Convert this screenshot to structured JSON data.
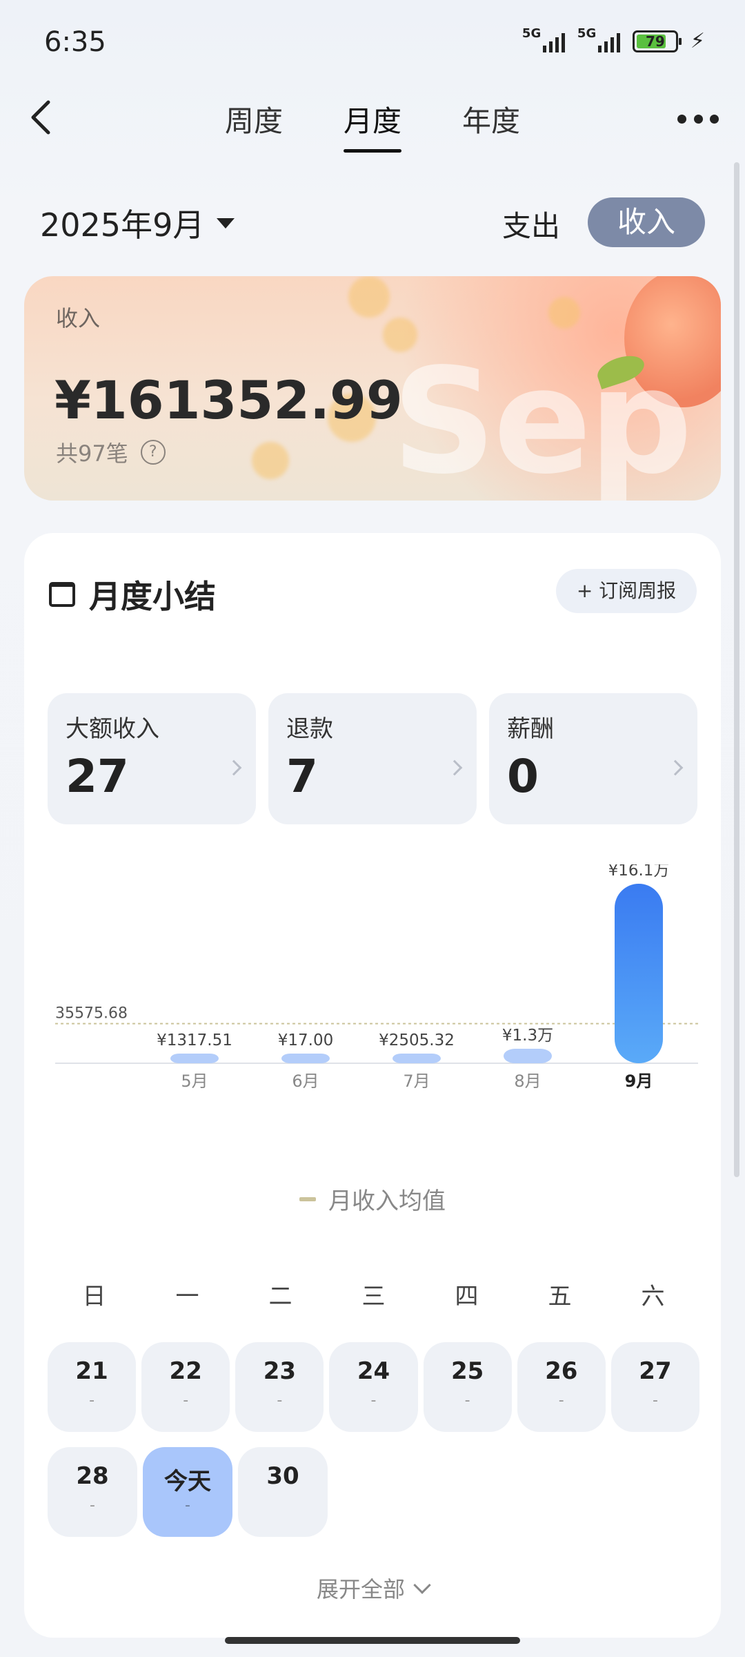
{
  "status": {
    "time": "6:35",
    "network1": "5G",
    "network2": "5G",
    "battery": "79"
  },
  "nav": {
    "tabs": [
      "周度",
      "月度",
      "年度"
    ],
    "active_tab": "月度"
  },
  "period": {
    "month_label": "2025年9月",
    "type_expense": "支出",
    "type_income": "收入",
    "selected_type": "收入"
  },
  "hero": {
    "label": "收入",
    "amount": "¥161352.99",
    "count": "共97笔",
    "watermark": "Sep"
  },
  "summary": {
    "title": "月度小结",
    "subscribe": "+ 订阅周报",
    "stats": [
      {
        "label": "大额收入",
        "value": "27"
      },
      {
        "label": "退款",
        "value": "7"
      },
      {
        "label": "薪酬",
        "value": "0"
      }
    ],
    "legend": "月收入均值",
    "weekdays": [
      "日",
      "一",
      "二",
      "三",
      "四",
      "五",
      "六"
    ],
    "calendar_rows": [
      [
        {
          "num": "21",
          "sub": "-"
        },
        {
          "num": "22",
          "sub": "-"
        },
        {
          "num": "23",
          "sub": "-"
        },
        {
          "num": "24",
          "sub": "-"
        },
        {
          "num": "25",
          "sub": "-"
        },
        {
          "num": "26",
          "sub": "-"
        },
        {
          "num": "27",
          "sub": "-"
        }
      ],
      [
        {
          "num": "28",
          "sub": "-"
        },
        {
          "num": "今天",
          "sub": "-",
          "today": true
        },
        {
          "num": "30",
          "sub": ""
        }
      ]
    ],
    "expand": "展开全部"
  },
  "chart_data": {
    "type": "bar",
    "categories": [
      "5月",
      "6月",
      "7月",
      "8月",
      "9月"
    ],
    "values": [
      1317.51,
      17.0,
      2505.32,
      13000,
      161352.99
    ],
    "value_labels": [
      "¥1317.51",
      "¥17.00",
      "¥2505.32",
      "¥1.3万",
      "¥16.1万"
    ],
    "average": 35575.68,
    "average_label": "35575.68",
    "selected_category": "9月",
    "colors": {
      "bar": "#b3cdfa",
      "selected_top": "#3a7bf1",
      "selected_bottom": "#5aaaf8",
      "average_line": "#cbc39b"
    }
  }
}
